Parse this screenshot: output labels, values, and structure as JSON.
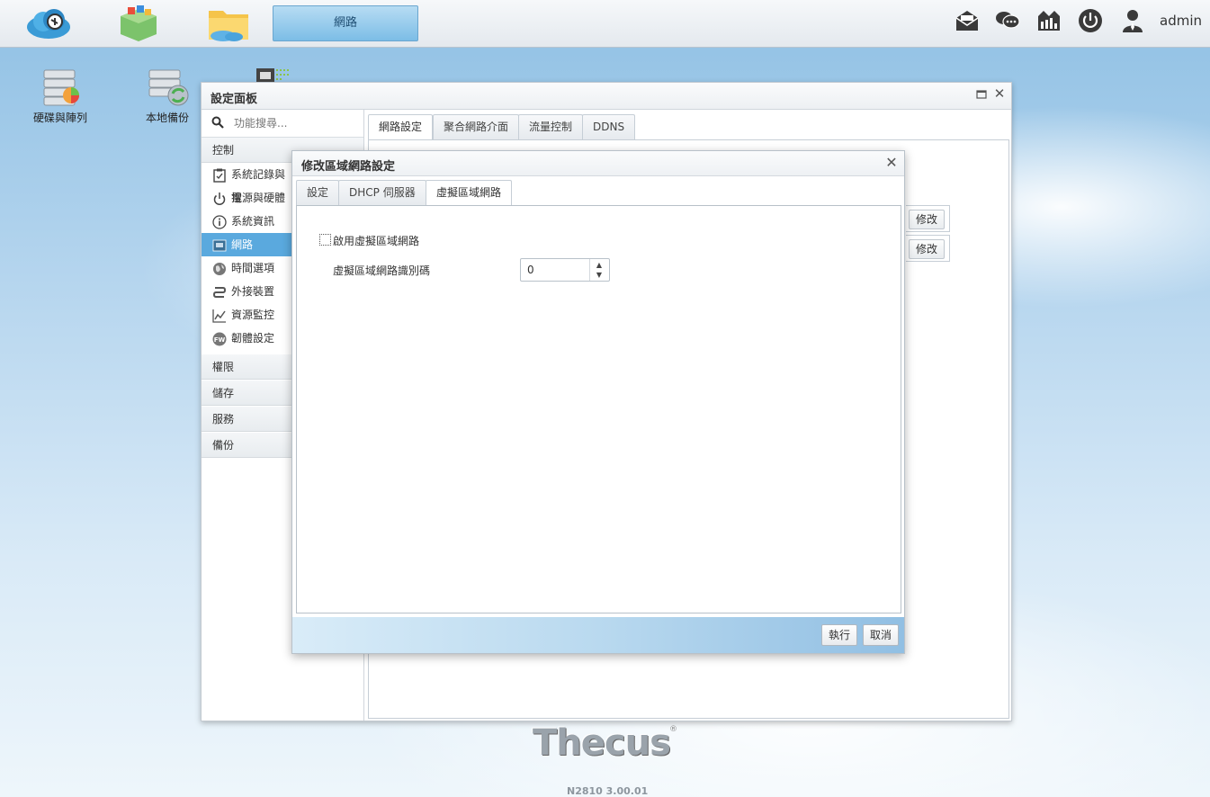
{
  "taskbar": {
    "active_app": "網路",
    "user": "admin"
  },
  "desktop": {
    "icons": [
      {
        "label": "硬碟與陣列"
      },
      {
        "label": "本地備份"
      }
    ]
  },
  "settings_window": {
    "title": "設定面板",
    "search_placeholder": "功能搜尋...",
    "groups": {
      "control": "控制",
      "privilege": "權限",
      "storage": "儲存",
      "service": "服務",
      "backup": "備份"
    },
    "items": [
      {
        "label": "系統記錄與搜"
      },
      {
        "label": "電源與硬體"
      },
      {
        "label": "系統資訊"
      },
      {
        "label": "網路"
      },
      {
        "label": "時間選項"
      },
      {
        "label": "外接裝置"
      },
      {
        "label": "資源監控"
      },
      {
        "label": "韌體設定"
      }
    ],
    "tabs": [
      "網路設定",
      "聚合網路介面",
      "流量控制",
      "DDNS"
    ],
    "modify_label": "修改"
  },
  "dialog": {
    "title": "修改區域網路設定",
    "tabs": [
      "設定",
      "DHCP 伺服器",
      "虛擬區域網路"
    ],
    "enable_vlan_label": "啟用虛擬區域網路",
    "vlan_id_label": "虛擬區域網路識別碼",
    "vlan_id_value": "0",
    "apply_label": "執行",
    "cancel_label": "取消"
  },
  "footer": {
    "brand": "Thecus",
    "registered": "®",
    "version": "N2810   3.00.01"
  }
}
